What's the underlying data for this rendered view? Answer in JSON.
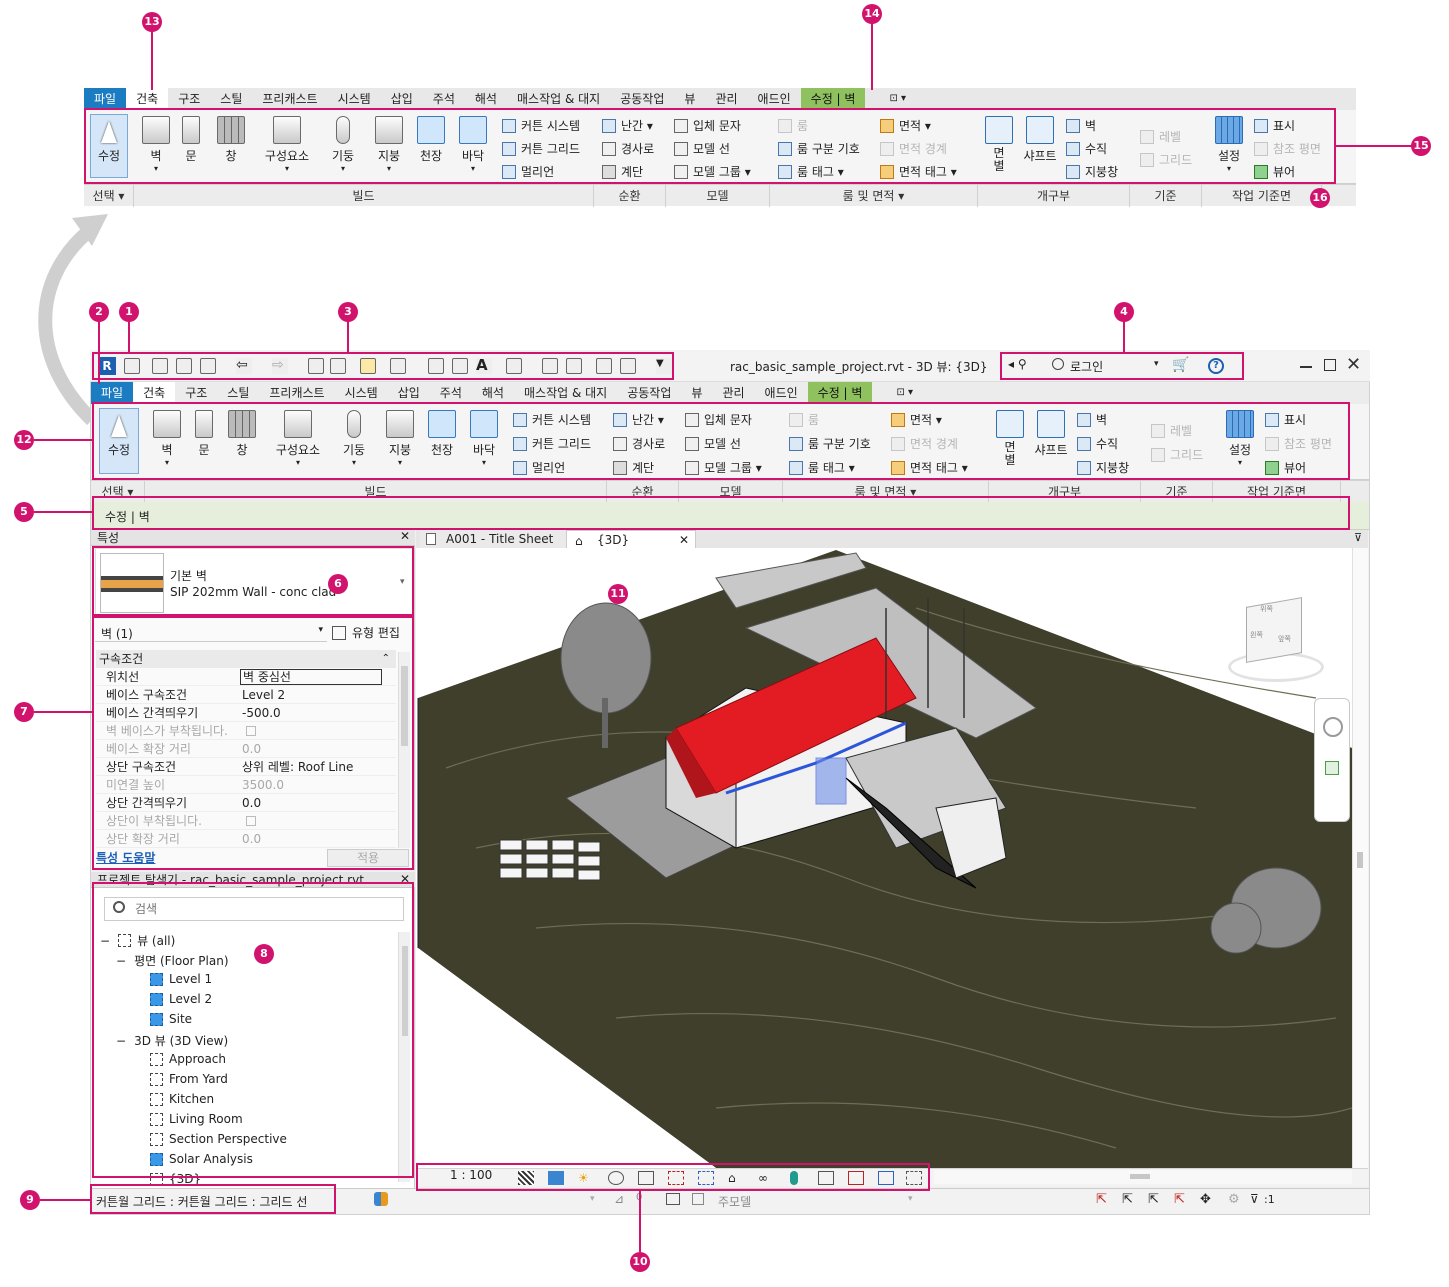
{
  "callouts": [
    "1",
    "2",
    "3",
    "4",
    "5",
    "6",
    "7",
    "8",
    "9",
    "10",
    "11",
    "12",
    "13",
    "14",
    "15",
    "16"
  ],
  "ribbon_tabs": [
    "파일",
    "건축",
    "구조",
    "스틸",
    "프리캐스트",
    "시스템",
    "삽입",
    "주석",
    "해석",
    "매스작업 & 대지",
    "공동작업",
    "뷰",
    "관리",
    "애드인",
    "수정 | 벽",
    "⊡ ▾"
  ],
  "ribbon": {
    "select": "수정",
    "select_panel": "선택 ▾",
    "build": {
      "wall": "벽",
      "door": "문",
      "window": "창",
      "component": "구성요소",
      "column": "기둥",
      "roof": "지붕",
      "ceiling": "천장",
      "floor": "바닥",
      "curtain_system": "커튼 시스템",
      "curtain_grid": "커튼 그리드",
      "mullion": "멀리언",
      "panel": "빌드"
    },
    "circulation": {
      "railing": "난간 ▾",
      "ramp": "경사로",
      "stair": "계단",
      "panel": "순환"
    },
    "model": {
      "model_text": "입체 문자",
      "model_line": "모델 선",
      "model_group": "모델 그룹 ▾",
      "panel": "모델"
    },
    "room_area": {
      "room": "룸",
      "room_separator": "룸 구분 기호",
      "room_tag": "룸 태그 ▾",
      "area": "면적 ▾",
      "area_boundary": "면적 경계",
      "area_tag": "면적 태그 ▾",
      "panel": "룸 및 면적 ▾"
    },
    "opening": {
      "by_face": "면\n별",
      "shaft": "샤프트",
      "wall": "벽",
      "vertical": "수직",
      "dormer": "지붕창",
      "panel": "개구부"
    },
    "datum": {
      "level": "레벨",
      "grid": "그리드",
      "panel": "기준"
    },
    "workplane": {
      "set": "설정",
      "show": "표시",
      "ref_plane": "참조 평면",
      "viewer": "뷰어",
      "panel": "작업 기준면"
    }
  },
  "titlebar": {
    "title": "rac_basic_sample_project.rvt - 3D 뷰: {3D}",
    "login": "로그인",
    "app_letter": "R"
  },
  "options_bar": "수정 | 벽",
  "properties": {
    "header": "특성",
    "type_name_1": "기본 벽",
    "type_name_2": "SIP 202mm Wall - conc clad",
    "filter": "벽 (1)",
    "edit_type": "유형 편집",
    "group": "구속조건",
    "rows": [
      {
        "k": "위치선",
        "v": "벽 중심선",
        "dis": false
      },
      {
        "k": "베이스 구속조건",
        "v": "Level 2",
        "dis": false
      },
      {
        "k": "베이스 간격띄우기",
        "v": "-500.0",
        "dis": false
      },
      {
        "k": "벽 베이스가 부착됩니다.",
        "v": "",
        "dis": true
      },
      {
        "k": "베이스 확장 거리",
        "v": "0.0",
        "dis": true
      },
      {
        "k": "상단 구속조건",
        "v": "상위 레벨: Roof Line",
        "dis": false
      },
      {
        "k": "미연결 높이",
        "v": "3500.0",
        "dis": true
      },
      {
        "k": "상단 간격띄우기",
        "v": "0.0",
        "dis": false
      },
      {
        "k": "상단이 부착됩니다.",
        "v": "",
        "dis": true
      },
      {
        "k": "상단 확장 거리",
        "v": "0.0",
        "dis": true
      }
    ],
    "help_link": "특성 도움말",
    "apply": "적용"
  },
  "browser": {
    "header": "프로젝트 탐색기 - rac_basic_sample_project.rvt",
    "search_placeholder": "검색",
    "root": "뷰 (all)",
    "floor_plan": "평면 (Floor Plan)",
    "floor_items": [
      "Level 1",
      "Level 2",
      "Site"
    ],
    "view3d": "3D 뷰 (3D View)",
    "view3d_items": [
      "Approach",
      "From Yard",
      "Kitchen",
      "Living Room",
      "Section Perspective",
      "Solar Analysis",
      "{3D}"
    ]
  },
  "view_tabs": {
    "sheet": "A001 - Title Sheet",
    "active": "{3D}"
  },
  "view_control": {
    "scale": "1 : 100"
  },
  "status": {
    "text": "커튼월 그리드 : 커튼월 그리드 : 그리드 선",
    "workset": "주모델",
    "filter_count": ":1",
    "zero": "0"
  },
  "viewcube": {
    "top_label": "위쪽",
    "left_label": "왼쪽",
    "front_label": "앞쪽"
  },
  "colors": {
    "accent": "#d1136e",
    "file_tab": "#1c7cc2",
    "context_tab": "#8fc25f",
    "roof": "#e31b23",
    "ground": "#3f3f2c"
  }
}
